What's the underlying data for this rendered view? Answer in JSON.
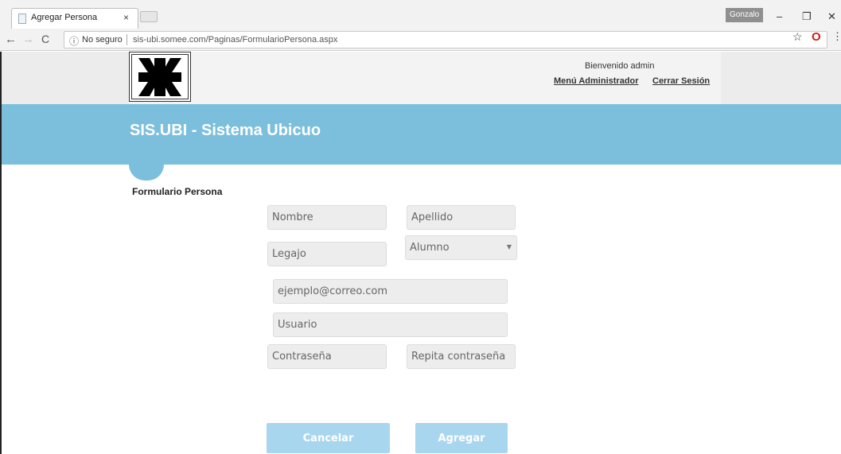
{
  "browser": {
    "tab_title": "Agregar Persona",
    "tab_close": "×",
    "profile_name": "Gonzalo",
    "security_label": "No seguro",
    "url": "sis-ubi.somee.com/Paginas/FormularioPersona.aspx"
  },
  "header": {
    "welcome": "Bienvenido admin",
    "admin_menu_link": "Menú Administrador",
    "logout_link": "Cerrar Sesión"
  },
  "banner": {
    "title": "SIS.UBI - Sistema Ubicuo"
  },
  "form": {
    "title": "Formulario Persona",
    "fields": {
      "nombre": "Nombre",
      "apellido": "Apellido",
      "legajo": "Legajo",
      "rol_selected": "Alumno",
      "email": "ejemplo@correo.com",
      "usuario": "Usuario",
      "contrasena": "Contraseña",
      "repetir_contrasena": "Repita contraseña"
    },
    "cancel_label": "Cancelar",
    "submit_label": "Agregar"
  },
  "colors": {
    "banner": "#7bbfdd",
    "button": "#a9d6ef"
  }
}
